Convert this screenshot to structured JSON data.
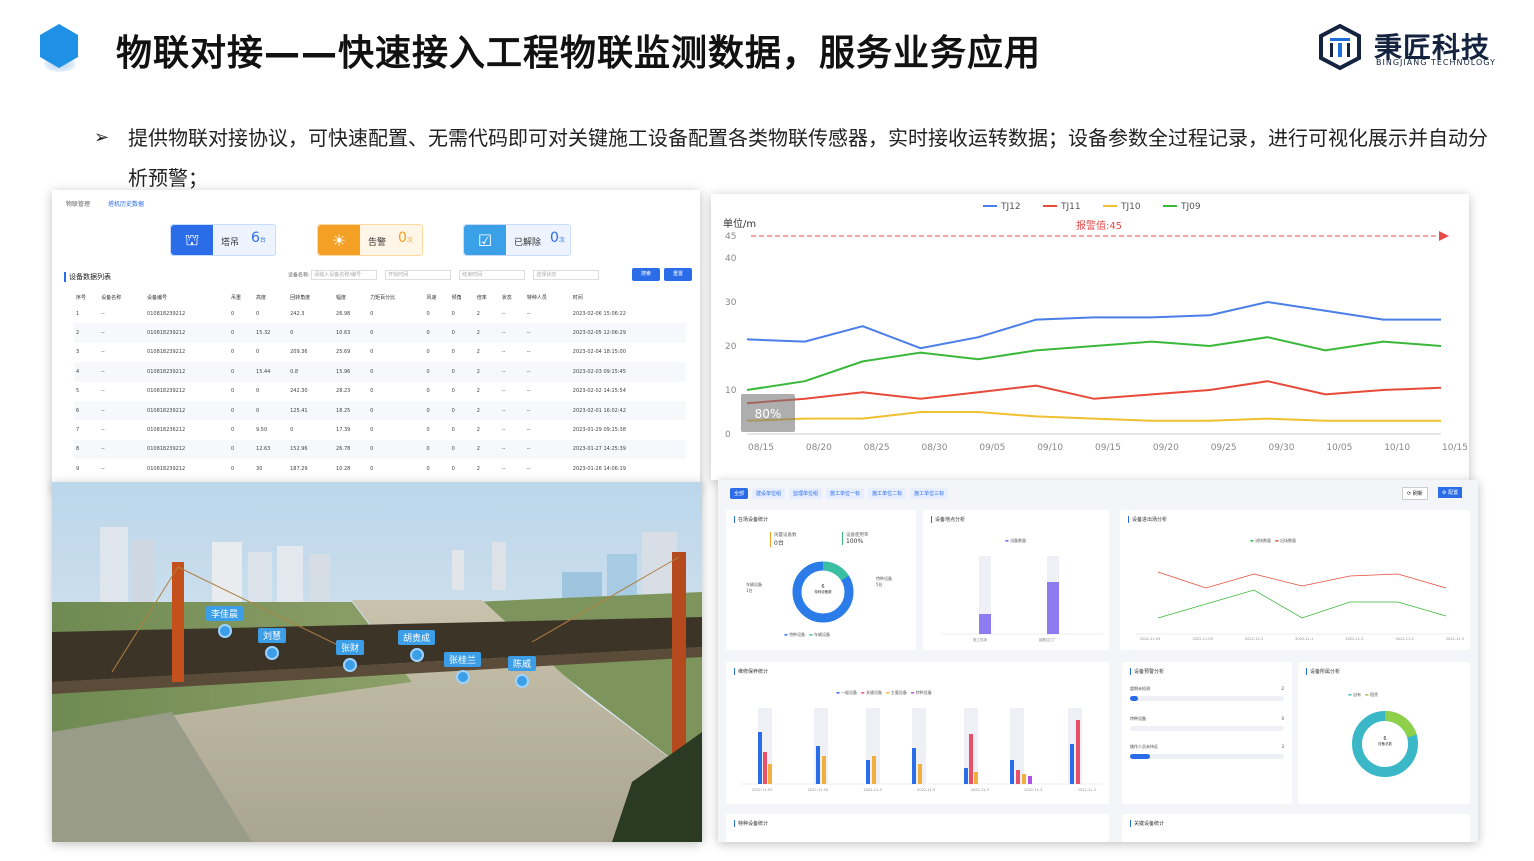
{
  "header": {
    "title": "物联对接——快速接入工程物联监测数据，服务业务应用",
    "logo_cn": "秉匠科技",
    "logo_en": "BINGJIANG TECHNOLOGY"
  },
  "bullet": {
    "marker": "➢",
    "text": "提供物联对接协议，可快速配置、无需代码即可对关键施工设备配置各类物联传感器，实时接收运转数据；设备参数全过程记录，进行可视化展示并自动分析预警；"
  },
  "table_panel": {
    "tabs": [
      "物联管理",
      "塔机历史数据"
    ],
    "stats": [
      {
        "label": "塔吊",
        "value": "6",
        "unit": "台",
        "color": "#2b6de8",
        "icon": "crane-icon"
      },
      {
        "label": "告警",
        "value": "0",
        "unit": "次",
        "color": "#f4a025",
        "icon": "alarm-icon"
      },
      {
        "label": "已解除",
        "value": "0",
        "unit": "次",
        "color": "#3aa0e8",
        "icon": "check-icon"
      }
    ],
    "section_title": "设备数据列表",
    "filter_label": "设备名称:",
    "filter_placeholders": [
      "请输入设备名称/编号",
      "开始时间",
      "结束时间",
      "选择状态"
    ],
    "buttons": {
      "search": "搜索",
      "reset": "重置"
    },
    "columns": [
      "序号",
      "设备名称",
      "设备编号",
      "吊重",
      "高度",
      "回转角度",
      "幅度",
      "力矩百分比",
      "风速",
      "倾角",
      "倍率",
      "状态",
      "特种人员",
      "时间"
    ],
    "rows": [
      [
        "1",
        "--",
        "010818239212",
        "0",
        "0",
        "242.3",
        "26.98",
        "0",
        "0",
        "0",
        "2",
        "--",
        "--",
        "2023-02-06 15:06:22"
      ],
      [
        "2",
        "--",
        "010818239212",
        "0",
        "15.32",
        "0",
        "10.63",
        "0",
        "0",
        "0",
        "2",
        "--",
        "--",
        "2023-02-05 12:06:29"
      ],
      [
        "3",
        "--",
        "010818239212",
        "0",
        "0",
        "209.36",
        "25.69",
        "0",
        "0",
        "0",
        "2",
        "--",
        "--",
        "2023-02-04 18:15:00"
      ],
      [
        "4",
        "--",
        "010818239212",
        "0",
        "15.44",
        "0.8",
        "15.96",
        "0",
        "0",
        "0",
        "2",
        "--",
        "--",
        "2023-02-03 09:15:45"
      ],
      [
        "5",
        "--",
        "010818239212",
        "0",
        "0",
        "242.30",
        "28.23",
        "0",
        "0",
        "0",
        "2",
        "--",
        "--",
        "2023-02-02 14:15:54"
      ],
      [
        "6",
        "--",
        "010818239212",
        "0",
        "0",
        "125.41",
        "18.25",
        "0",
        "0",
        "0",
        "2",
        "--",
        "--",
        "2023-02-01 16:02:42"
      ],
      [
        "7",
        "--",
        "010818236212",
        "0",
        "9.50",
        "0",
        "17.39",
        "0",
        "0",
        "0",
        "2",
        "--",
        "--",
        "2023-01-29 09:15:38"
      ],
      [
        "8",
        "--",
        "010818239212",
        "0",
        "12.63",
        "152.96",
        "26.78",
        "0",
        "0",
        "0",
        "2",
        "--",
        "--",
        "2023-01-27 14:25:39"
      ],
      [
        "9",
        "--",
        "010818239212",
        "0",
        "30",
        "187.29",
        "10.28",
        "0",
        "0",
        "0",
        "2",
        "--",
        "--",
        "2023-01-26 14:06:19"
      ]
    ]
  },
  "chart_data": [
    {
      "type": "line",
      "ylabel": "单位/m",
      "ylim": [
        0,
        45
      ],
      "yticks": [
        0,
        10,
        20,
        30,
        40,
        45
      ],
      "x": [
        "08/15",
        "08/20",
        "08/25",
        "08/30",
        "09/05",
        "09/10",
        "09/15",
        "09/20",
        "09/25",
        "09/30",
        "10/05",
        "10/10",
        "10/15"
      ],
      "threshold": {
        "label": "报警值:45",
        "value": 45,
        "color": "#e84a4a"
      },
      "series": [
        {
          "name": "TJ12",
          "color": "#4a7ee8",
          "values": [
            21.5,
            21,
            24.5,
            19.5,
            22,
            26,
            26.5,
            26.5,
            27,
            30,
            28,
            26,
            26
          ]
        },
        {
          "name": "TJ11",
          "color": "#e84a3a",
          "values": [
            7,
            8,
            9.5,
            8,
            9.5,
            11,
            8,
            9,
            10,
            12,
            9,
            10,
            10.5
          ]
        },
        {
          "name": "TJ10",
          "color": "#f0c030",
          "values": [
            3,
            3.5,
            3.5,
            5,
            5,
            4,
            3.5,
            3,
            3,
            3.5,
            3,
            3,
            3
          ]
        },
        {
          "name": "TJ09",
          "color": "#3ab83a",
          "values": [
            10,
            12,
            16.5,
            18.5,
            17,
            19,
            20,
            21,
            20,
            22,
            19,
            21,
            20
          ]
        }
      ],
      "badge": "80%"
    }
  ],
  "scene_3d": {
    "workers": [
      "李佳晨",
      "刘慧",
      "张财",
      "胡贵成",
      "张桂兰",
      "陈威"
    ]
  },
  "dashboard": {
    "tabs": [
      "全部",
      "建设单位组",
      "监理单位组",
      "施工单位一标",
      "施工单位二标",
      "施工单位三标"
    ],
    "buttons": {
      "refresh": "刷新",
      "config": "配置"
    },
    "cards": {
      "onsite": {
        "title": "在场设备统计",
        "kpi1_label": "闲置设备数",
        "kpi1_value": "0台",
        "kpi2_label": "设备使用率",
        "kpi2_value": "100%",
        "center_value": "6",
        "center_label": "特种设备数",
        "left_label": "车辆设备",
        "left_value": "1台",
        "right_label": "特种设备",
        "right_value": "5台",
        "legend": [
          "特种设备",
          "车辆设备"
        ]
      },
      "location": {
        "title": "设备地点分析",
        "legend": "设备数量",
        "categories": [
          "施工现场",
          "钢筋加工厂"
        ]
      },
      "inout": {
        "title": "设备进出场分析",
        "legend": [
          "进场数量",
          "出场数量"
        ],
        "categories": [
          "2022-11-03",
          "2022-11-03",
          "2022-11-3",
          "2022-11-1",
          "2022-11-3",
          "2022-11-2",
          "2022-11-3"
        ]
      },
      "maintain": {
        "title": "维修保养统计",
        "legend": [
          "一般设备",
          "关键设备",
          "主要设备",
          "特种设备"
        ],
        "categories": [
          "2022-11-03",
          "2022-11-04",
          "2022-11-3",
          "2022-11-5",
          "2022-11-3",
          "2022-11-2",
          "2022-11-3"
        ]
      },
      "warning": {
        "title": "设备预警分析",
        "items": [
          {
            "label": "超期未检测",
            "value": "2"
          },
          {
            "label": "特种设备",
            "value": "0"
          },
          {
            "label": "操作人员未持证",
            "value": "3"
          }
        ]
      },
      "owner": {
        "title": "设备所属分析",
        "legend": [
          "自有",
          "租赁"
        ],
        "center_value": "6",
        "center_label": "设备总数"
      },
      "special": {
        "title": "特种设备统计"
      },
      "key": {
        "title": "关键设备统计"
      }
    }
  }
}
